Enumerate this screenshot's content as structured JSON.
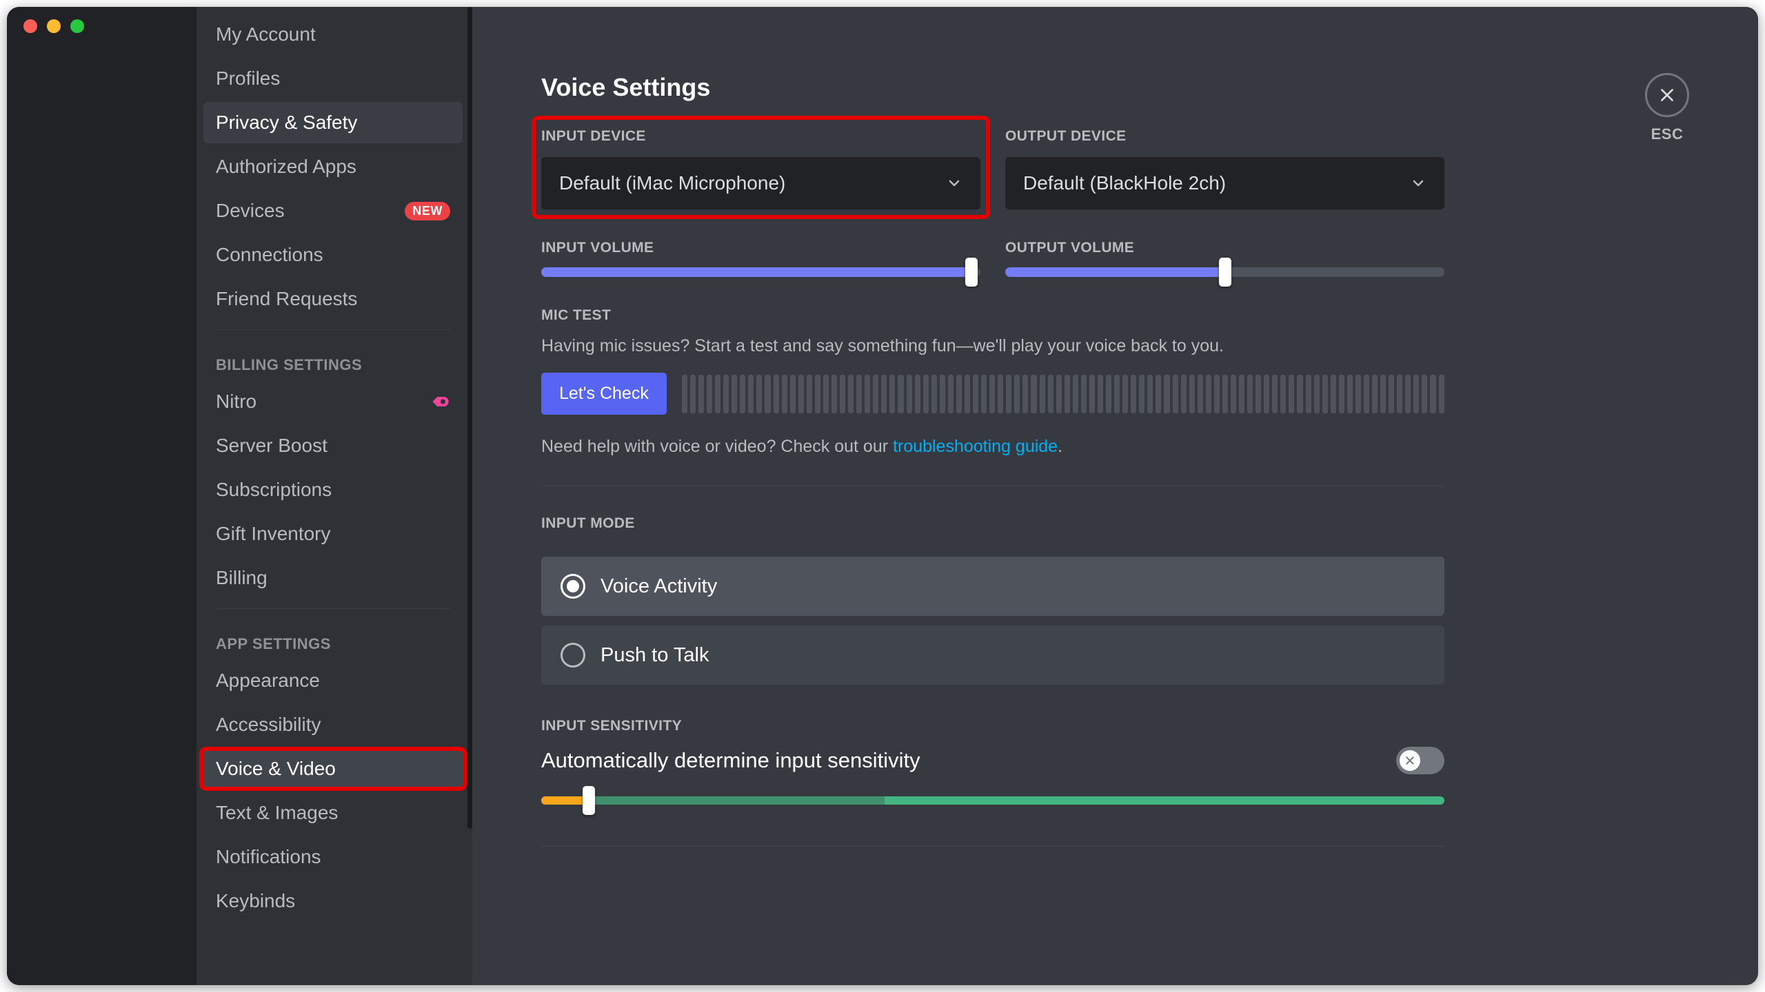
{
  "sidebar": {
    "user_settings": [
      {
        "label": "My Account"
      },
      {
        "label": "Profiles"
      },
      {
        "label": "Privacy & Safety",
        "selected": true
      },
      {
        "label": "Authorized Apps"
      },
      {
        "label": "Devices",
        "badge": "NEW"
      },
      {
        "label": "Connections"
      },
      {
        "label": "Friend Requests"
      }
    ],
    "billing_heading": "BILLING SETTINGS",
    "billing": [
      {
        "label": "Nitro",
        "nitro": true
      },
      {
        "label": "Server Boost"
      },
      {
        "label": "Subscriptions"
      },
      {
        "label": "Gift Inventory"
      },
      {
        "label": "Billing"
      }
    ],
    "app_heading": "APP SETTINGS",
    "app": [
      {
        "label": "Appearance"
      },
      {
        "label": "Accessibility"
      },
      {
        "label": "Voice & Video",
        "selected": true,
        "highlight": true
      },
      {
        "label": "Text & Images"
      },
      {
        "label": "Notifications"
      },
      {
        "label": "Keybinds"
      }
    ]
  },
  "main": {
    "title": "Voice Settings",
    "input_device_label": "INPUT DEVICE",
    "input_device_value": "Default (iMac Microphone)",
    "output_device_label": "OUTPUT DEVICE",
    "output_device_value": "Default (BlackHole 2ch)",
    "input_volume_label": "INPUT VOLUME",
    "input_volume_pct": 98,
    "output_volume_label": "OUTPUT VOLUME",
    "output_volume_pct": 50,
    "mic_test_label": "MIC TEST",
    "mic_test_desc": "Having mic issues? Start a test and say something fun—we'll play your voice back to you.",
    "lets_check": "Let's Check",
    "help_prefix": "Need help with voice or video? Check out our ",
    "help_link": "troubleshooting guide",
    "help_suffix": ".",
    "input_mode_label": "INPUT MODE",
    "mode_voice": "Voice Activity",
    "mode_ptt": "Push to Talk",
    "sens_label": "INPUT SENSITIVITY",
    "sens_auto": "Automatically determine input sensitivity",
    "esc": "ESC"
  }
}
